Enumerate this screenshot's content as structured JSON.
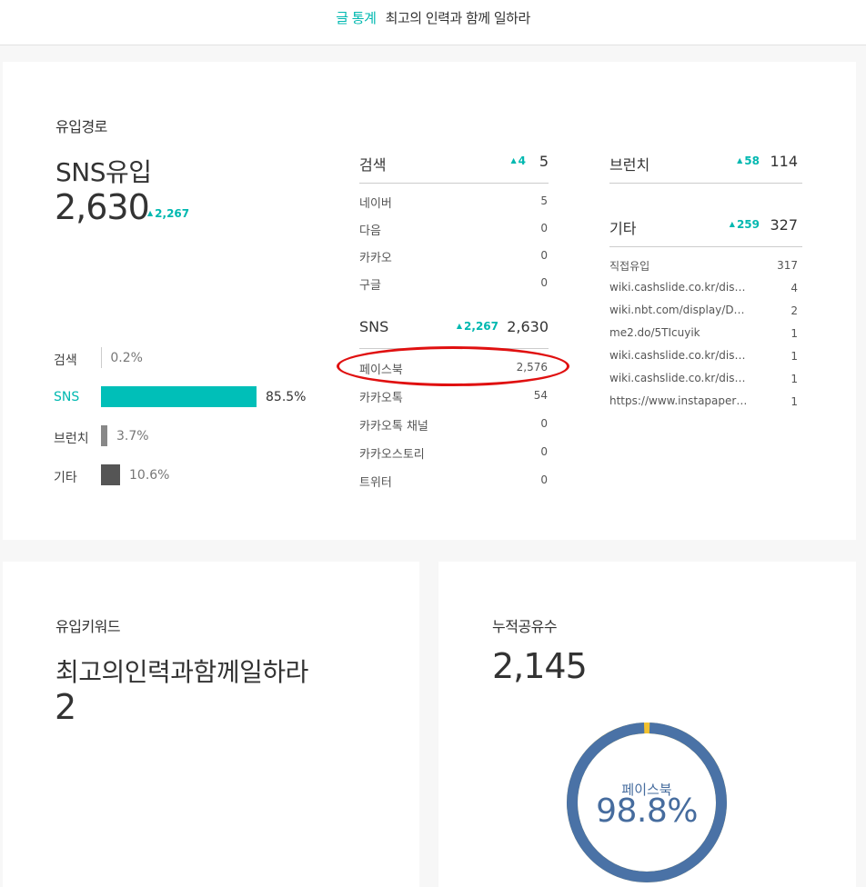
{
  "header": {
    "category": "글 통계",
    "title": "최고의 인력과 함께 일하라"
  },
  "inflow": {
    "section_label": "유입경로",
    "main_label": "SNS유입",
    "main_value": "2,630",
    "main_delta": "2,267",
    "bars": [
      {
        "label": "검색",
        "percent_text": "0.2%",
        "percent": 0.2,
        "color": "#cccccc",
        "highlight": false
      },
      {
        "label": "SNS",
        "percent_text": "85.5%",
        "percent": 85.5,
        "color": "#00bfb8",
        "highlight": true
      },
      {
        "label": "브런치",
        "percent_text": "3.7%",
        "percent": 3.7,
        "color": "#888888",
        "highlight": false
      },
      {
        "label": "기타",
        "percent_text": "10.6%",
        "percent": 10.6,
        "color": "#555555",
        "highlight": false
      }
    ],
    "search": {
      "name": "검색",
      "delta": "4",
      "total": "5",
      "items": [
        {
          "name": "네이버",
          "count": "5"
        },
        {
          "name": "다음",
          "count": "0"
        },
        {
          "name": "카카오",
          "count": "0"
        },
        {
          "name": "구글",
          "count": "0"
        }
      ]
    },
    "sns": {
      "name": "SNS",
      "delta": "2,267",
      "total": "2,630",
      "items": [
        {
          "name": "페이스북",
          "count": "2,576"
        },
        {
          "name": "카카오톡",
          "count": "54"
        },
        {
          "name": "카카오톡 채널",
          "count": "0"
        },
        {
          "name": "카카오스토리",
          "count": "0"
        },
        {
          "name": "트위터",
          "count": "0"
        }
      ]
    },
    "brunch": {
      "name": "브런치",
      "delta": "58",
      "total": "114"
    },
    "other": {
      "name": "기타",
      "delta": "259",
      "total": "327",
      "items": [
        {
          "name": "직접유입",
          "count": "317"
        },
        {
          "name": "wiki.cashslide.co.kr/dis…",
          "count": "4"
        },
        {
          "name": "wiki.nbt.com/display/D…",
          "count": "2"
        },
        {
          "name": "me2.do/5TIcuyik",
          "count": "1"
        },
        {
          "name": "wiki.cashslide.co.kr/dis…",
          "count": "1"
        },
        {
          "name": "wiki.cashslide.co.kr/dis…",
          "count": "1"
        },
        {
          "name": "https://www.instapaper…",
          "count": "1"
        }
      ]
    }
  },
  "keyword": {
    "section_label": "유입키워드",
    "keyword": "최고의인력과함께일하라",
    "count": "2"
  },
  "shares": {
    "section_label": "누적공유수",
    "total": "2,145",
    "donut_label": "페이스북",
    "donut_percent_text": "98.8%",
    "donut_percent": 98.8,
    "colors": {
      "main": "#4a72a6",
      "rest": "#f2c12e"
    }
  },
  "colors": {
    "accent": "#00b8b0",
    "annotation": "#e01010"
  }
}
